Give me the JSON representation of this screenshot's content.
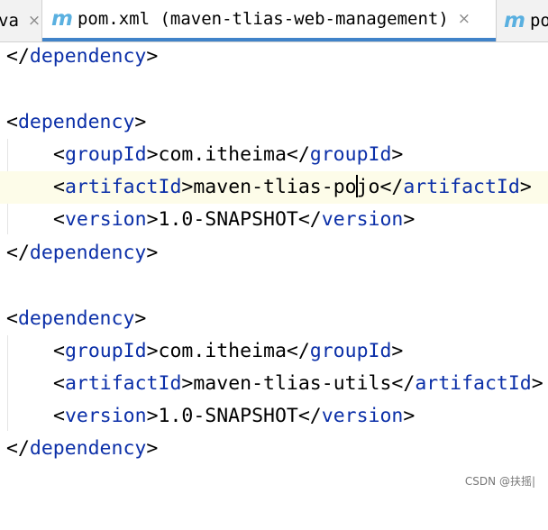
{
  "tabs": [
    {
      "label": "va",
      "close": "×"
    },
    {
      "label": "pom.xml (maven-tlias-web-management)",
      "icon_letter": "m",
      "close": "×",
      "active": true
    },
    {
      "label": "po",
      "icon_letter": "m"
    }
  ],
  "editor": {
    "lines": [
      {
        "parts": [
          "</",
          "dependency",
          ">"
        ]
      },
      {
        "parts": []
      },
      {
        "parts": [
          "<",
          "dependency",
          ">"
        ]
      },
      {
        "parts": [
          "<",
          "groupId",
          ">",
          "com.itheima",
          "</",
          "groupId",
          ">"
        ]
      },
      {
        "parts": [
          "<",
          "artifactId",
          ">",
          "maven-tlias-po",
          "jo",
          "</",
          "artifactId",
          ">"
        ]
      },
      {
        "parts": [
          "<",
          "version",
          ">",
          "1.0-SNAPSHOT",
          "</",
          "version",
          ">"
        ]
      },
      {
        "parts": [
          "</",
          "dependency",
          ">"
        ]
      },
      {
        "parts": []
      },
      {
        "parts": [
          "<",
          "dependency",
          ">"
        ]
      },
      {
        "parts": [
          "<",
          "groupId",
          ">",
          "com.itheima",
          "</",
          "groupId",
          ">"
        ]
      },
      {
        "parts": [
          "<",
          "artifactId",
          ">",
          "maven-tlias-utils",
          "</",
          "artifactId",
          ">"
        ]
      },
      {
        "parts": [
          "<",
          "version",
          ">",
          "1.0-SNAPSHOT",
          "</",
          "version",
          ">"
        ]
      },
      {
        "parts": [
          "</",
          "dependency",
          ">"
        ]
      }
    ]
  },
  "watermark": "CSDN @扶摇|",
  "colors": {
    "tag": "#0b2fa8",
    "text": "#000000",
    "current_line": "#fdfce9",
    "tab_underline": "#4083c9",
    "maven_icon": "#5ab0e0"
  },
  "icons": {
    "maven_file": "m-icon",
    "close": "close-icon"
  }
}
